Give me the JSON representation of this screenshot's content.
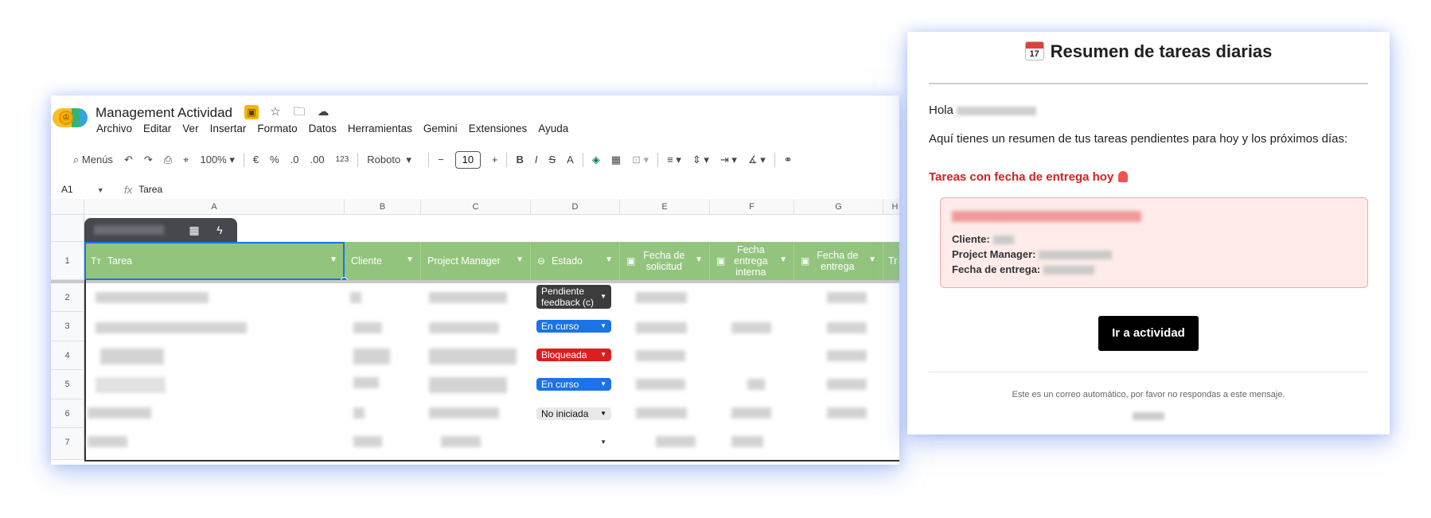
{
  "sheet": {
    "title": "Management Actividad",
    "menu": [
      "Archivo",
      "Editar",
      "Ver",
      "Insertar",
      "Formato",
      "Datos",
      "Herramientas",
      "Gemini",
      "Extensiones",
      "Ayuda"
    ],
    "toolbar": {
      "search_label": "Menús",
      "zoom": "100%",
      "currency": "€",
      "percent": "%",
      "dec_decrease": ".0",
      "dec_increase": ".00",
      "number_format": "123",
      "font": "Roboto",
      "font_size": "10",
      "minus": "−",
      "plus": "+",
      "bold": "B",
      "italic": "I",
      "strike": "S",
      "text_color": "A"
    },
    "formula": {
      "cell_ref": "A1",
      "fx": "fx",
      "value": "Tarea"
    },
    "columns": [
      "A",
      "B",
      "C",
      "D",
      "E",
      "F",
      "G",
      "H"
    ],
    "headers": [
      "Tarea",
      "Cliente",
      "Project Manager",
      "Estado",
      "Fecha de solicitud",
      "Fecha entrega interna",
      "Fecha de entrega",
      "Tr"
    ],
    "rows": [
      "1",
      "2",
      "3",
      "4",
      "5",
      "6",
      "7"
    ],
    "statuses": [
      "Pendiente feedback (c)",
      "En curso",
      "Bloqueada",
      "En curso",
      "No iniciada",
      ""
    ],
    "status_colors": {
      "pendiente": "#3c3c3c",
      "en_curso": "#1a73e8",
      "bloqueada": "#dd1e1e",
      "no_iniciada": "#e8e8e8",
      "header_green": "#93c47d"
    }
  },
  "email": {
    "calendar_month": "July",
    "calendar_day": "17",
    "title": "Resumen de tareas diarias",
    "greeting": "Hola",
    "intro": "Aquí tienes un resumen de tus tareas pendientes para hoy y los próximos días:",
    "due_today_heading": "Tareas con fecha de entrega hoy",
    "fields": {
      "cliente": "Cliente:",
      "pm": "Project Manager:",
      "fecha": "Fecha de entrega:"
    },
    "button": "Ir a actividad",
    "footer": "Este es un correo automático, por favor no respondas a este mensaje.",
    "accent_color": "#d61f1f"
  }
}
